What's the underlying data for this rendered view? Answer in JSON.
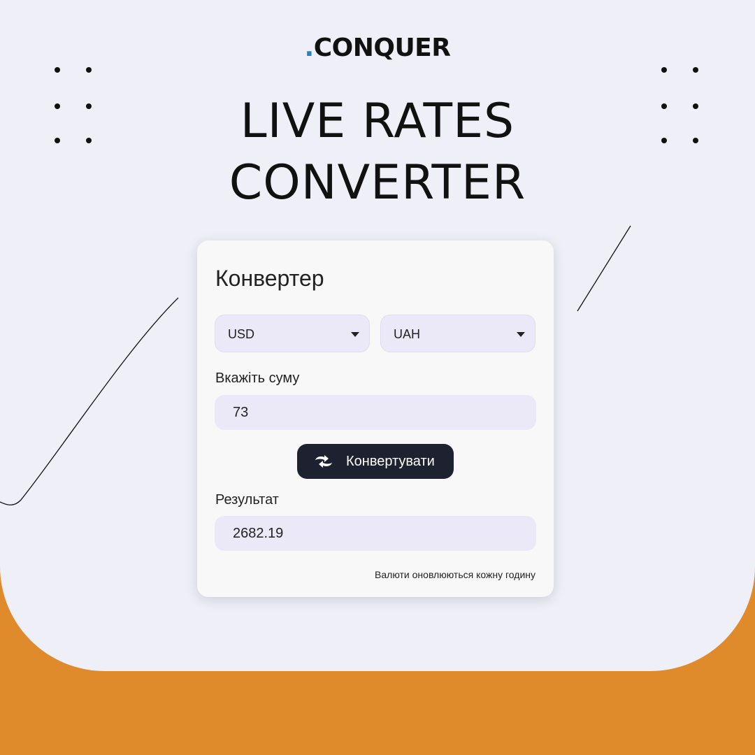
{
  "brand": {
    "dot": ".",
    "name": "CONQUER",
    "accent_color": "#1c86c9"
  },
  "headline": {
    "line1": "LIVE RATES",
    "line2": "CONVERTER"
  },
  "converter": {
    "title": "Конвертер",
    "from_currency": "USD",
    "to_currency": "UAH",
    "amount_label": "Вкажіть суму",
    "amount_value": "73",
    "convert_button": "Конвертувати",
    "result_label": "Результат",
    "result_value": "2682.19",
    "update_note": "Валюти оновлюються кожну годину"
  },
  "colors": {
    "background_panel": "#efeff8",
    "bottom_band": "#df8a2b",
    "field_fill": "#ebe8f7",
    "button_fill": "#1e2130"
  },
  "icons": {
    "convert_button_icon": "swap-arrows-icon",
    "select_caret": "caret-down-icon"
  }
}
